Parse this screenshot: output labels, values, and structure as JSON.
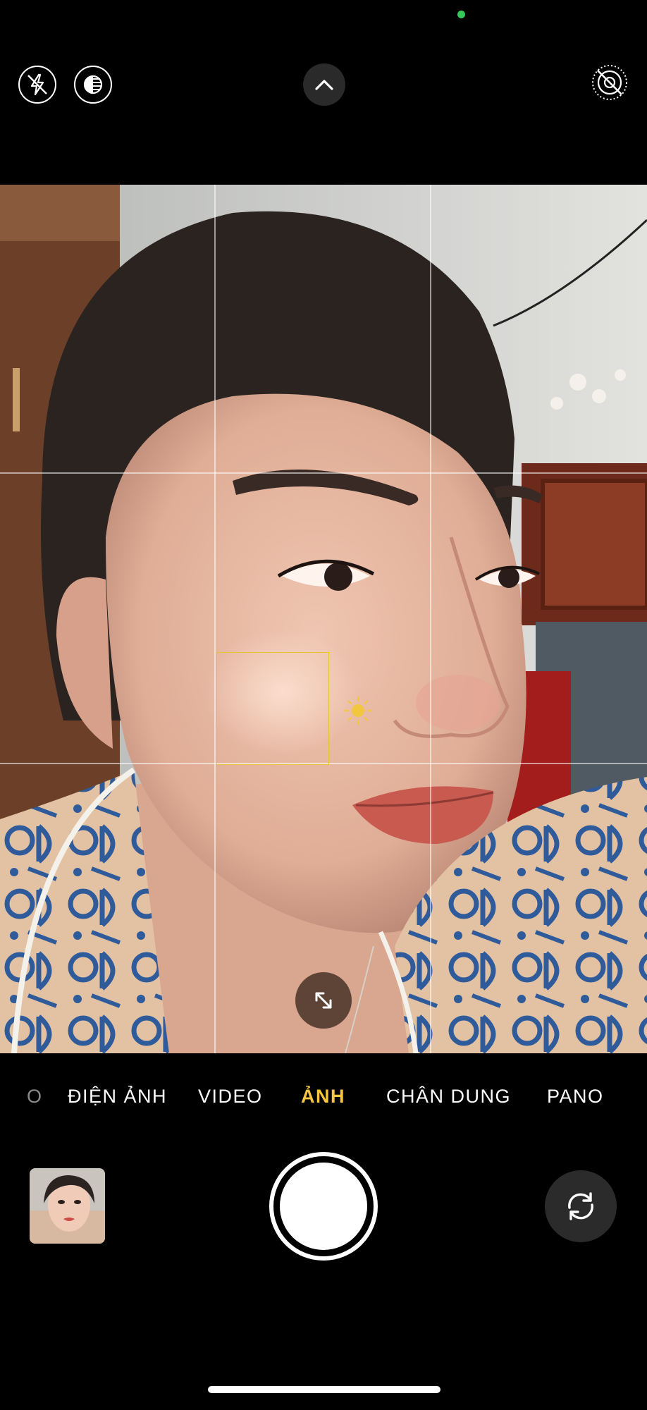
{
  "colors": {
    "background": "#000000",
    "status_dot": "#35c759",
    "accent_selected_mode": "#f5c542",
    "mode_text": "#ffffff",
    "focus_box": "#e6c23a"
  },
  "top_bar": {
    "icons": [
      "flash-off-icon",
      "live-off-icon",
      "chevron-up-icon",
      "live-photo-off-icon"
    ]
  },
  "viewfinder": {
    "icons": [
      "focus-box",
      "exposure-sun-icon",
      "expand-icon"
    ]
  },
  "modes": {
    "items": [
      {
        "label": "O",
        "selected": false
      },
      {
        "label": "ĐIỆN ẢNH",
        "selected": false
      },
      {
        "label": "VIDEO",
        "selected": false
      },
      {
        "label": "ẢNH",
        "selected": true
      },
      {
        "label": "CHÂN DUNG",
        "selected": false
      },
      {
        "label": "PANO",
        "selected": false
      }
    ]
  },
  "bottom_bar": {
    "icons": [
      "last-photo-thumbnail",
      "shutter-button",
      "camera-flip-icon"
    ]
  }
}
